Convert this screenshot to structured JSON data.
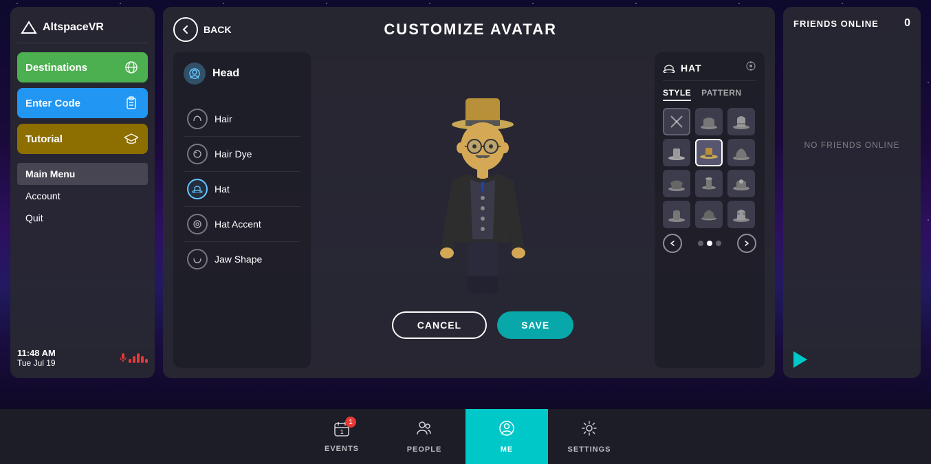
{
  "app": {
    "title": "AltspaceVR",
    "logo_symbol": "△"
  },
  "left_panel": {
    "nav_buttons": [
      {
        "id": "destinations",
        "label": "Destinations",
        "color": "#4caf50",
        "icon": "🌐"
      },
      {
        "id": "enter_code",
        "label": "Enter Code",
        "color": "#2196f3",
        "icon": "📋"
      },
      {
        "id": "tutorial",
        "label": "Tutorial",
        "color": "#8d6e00",
        "icon": "🎓"
      }
    ],
    "menu_items": [
      {
        "label": "Main Menu",
        "active": true
      },
      {
        "label": "Account",
        "active": false
      },
      {
        "label": "Quit",
        "active": false
      }
    ],
    "time": "11:48 AM",
    "date": "Tue Jul 19"
  },
  "center_panel": {
    "back_label": "BACK",
    "title": "CUSTOMIZE AVATAR",
    "head_section": {
      "label": "Head",
      "options": [
        {
          "id": "hair",
          "label": "Hair"
        },
        {
          "id": "hair_dye",
          "label": "Hair Dye"
        },
        {
          "id": "hat",
          "label": "Hat",
          "active": true
        },
        {
          "id": "hat_accent",
          "label": "Hat Accent"
        },
        {
          "id": "jaw_shape",
          "label": "Jaw Shape"
        }
      ]
    },
    "actions": {
      "cancel": "CANCEL",
      "save": "SAVE"
    }
  },
  "hat_panel": {
    "title": "HAT",
    "tabs": [
      {
        "label": "STYLE",
        "active": true
      },
      {
        "label": "PATTERN",
        "active": false
      }
    ],
    "selected_index": 4,
    "pagination": {
      "current_dot": 1,
      "total_dots": 3
    }
  },
  "right_panel": {
    "title": "FRIENDS ONLINE",
    "count": "0",
    "no_friends_label": "NO FRIENDS ONLINE"
  },
  "bottom_nav": {
    "items": [
      {
        "id": "events",
        "label": "EVENTS",
        "icon": "📅",
        "badge": "1",
        "active": false
      },
      {
        "id": "people",
        "label": "PEOPLE",
        "icon": "👥",
        "active": false
      },
      {
        "id": "me",
        "label": "ME",
        "icon": "☺",
        "active": true
      },
      {
        "id": "settings",
        "label": "SETTINGS",
        "icon": "⚙",
        "active": false
      }
    ]
  }
}
